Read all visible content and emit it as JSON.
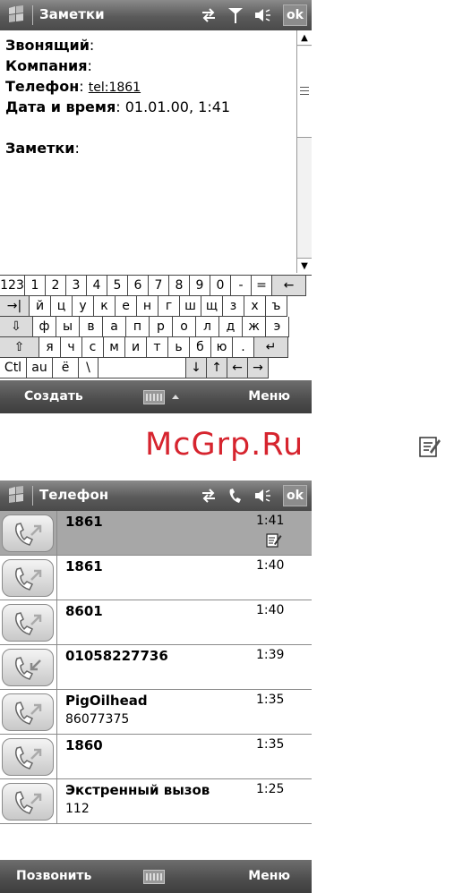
{
  "notes_screen": {
    "title": "Заметки",
    "ok_label": "ok",
    "fields": [
      {
        "key": "Звонящий",
        "value": ""
      },
      {
        "key": "Компания",
        "value": ""
      },
      {
        "key": "Телефон",
        "value": "tel:1861"
      },
      {
        "key": "Дата и время",
        "value": "01.01.00, 1:41"
      }
    ],
    "notes_label": "Заметки",
    "colon": ":",
    "keyboard": {
      "rows": [
        [
          "123",
          "1",
          "2",
          "3",
          "4",
          "5",
          "6",
          "7",
          "8",
          "9",
          "0",
          "-",
          "=",
          "←"
        ],
        [
          "→|",
          "й",
          "ц",
          "у",
          "к",
          "е",
          "н",
          "г",
          "ш",
          "щ",
          "з",
          "х",
          "ъ"
        ],
        [
          "⇩",
          "ф",
          "ы",
          "в",
          "а",
          "п",
          "р",
          "о",
          "л",
          "д",
          "ж",
          "э"
        ],
        [
          "⇧",
          "я",
          "ч",
          "с",
          "м",
          "и",
          "т",
          "ь",
          "б",
          "ю",
          ".",
          "↵"
        ],
        [
          "Ctl",
          "au",
          "ё",
          "\\",
          "",
          "↓",
          "↑",
          "←",
          "→"
        ]
      ]
    },
    "menu_left": "Создать",
    "menu_right": "Меню"
  },
  "watermark": "McGrp.Ru",
  "phone_screen": {
    "title": "Телефон",
    "ok_label": "ok",
    "calls": [
      {
        "name": "1861",
        "sub": "",
        "time": "1:41",
        "direction": "outgoing",
        "has_note": true,
        "selected": true
      },
      {
        "name": "1861",
        "sub": "",
        "time": "1:40",
        "direction": "outgoing",
        "has_note": false,
        "selected": false
      },
      {
        "name": "8601",
        "sub": "",
        "time": "1:40",
        "direction": "outgoing",
        "has_note": false,
        "selected": false
      },
      {
        "name": "01058227736",
        "sub": "",
        "time": "1:39",
        "direction": "incoming",
        "has_note": false,
        "selected": false
      },
      {
        "name": "PigOilhead",
        "sub": "86077375",
        "time": "1:35",
        "direction": "outgoing",
        "has_note": false,
        "selected": false
      },
      {
        "name": "1860",
        "sub": "",
        "time": "1:35",
        "direction": "outgoing",
        "has_note": false,
        "selected": false
      },
      {
        "name": "Экстренный вызов",
        "sub": "112",
        "time": "1:25",
        "direction": "outgoing",
        "has_note": false,
        "selected": false
      }
    ],
    "menu_left": "Позвонить",
    "menu_right": "Меню"
  },
  "icons": {
    "start": "windows-flag-icon",
    "connectivity": "connectivity-arrows-icon",
    "signal": "signal-antenna-icon",
    "volume": "speaker-icon",
    "phone_call": "phone-handset-icon",
    "note": "note-icon",
    "keyboard": "keyboard-icon"
  }
}
